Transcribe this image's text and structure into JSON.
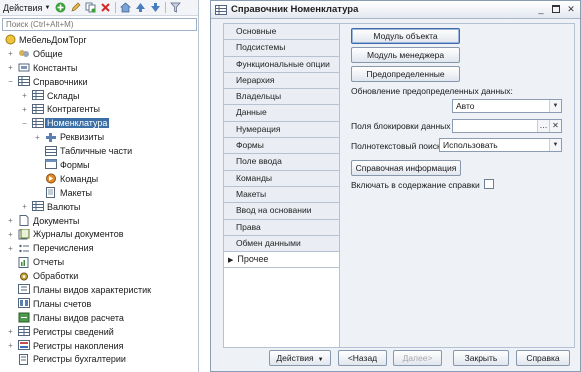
{
  "left_panel": {
    "toolbar": {
      "actions_label": "Действия",
      "icons": [
        "add-icon",
        "edit-icon",
        "copy-icon",
        "delete-icon",
        "home-icon",
        "move-up-icon",
        "move-down-icon",
        "filter-icon"
      ]
    },
    "search": {
      "placeholder": "Поиск (Ctrl+Alt+M)"
    },
    "tree": [
      {
        "label": "МебельДомТорг",
        "icon": "configuration-icon",
        "level": 0,
        "expander": ""
      },
      {
        "label": "Общие",
        "icon": "common-icon",
        "level": 1,
        "expander": "+"
      },
      {
        "label": "Константы",
        "icon": "constants-icon",
        "level": 1,
        "expander": "+"
      },
      {
        "label": "Справочники",
        "icon": "catalogs-icon",
        "level": 1,
        "expander": "−"
      },
      {
        "label": "Склады",
        "icon": "catalog-icon",
        "level": 2,
        "expander": "+"
      },
      {
        "label": "Контрагенты",
        "icon": "catalog-icon",
        "level": 2,
        "expander": "+"
      },
      {
        "label": "Номенклатура",
        "icon": "catalog-icon",
        "level": 2,
        "expander": "−",
        "selected": true
      },
      {
        "label": "Реквизиты",
        "icon": "attributes-icon",
        "level": 3,
        "expander": "+"
      },
      {
        "label": "Табличные части",
        "icon": "tabular-sections-icon",
        "level": 3,
        "expander": ""
      },
      {
        "label": "Формы",
        "icon": "forms-icon",
        "level": 3,
        "expander": ""
      },
      {
        "label": "Команды",
        "icon": "commands-icon",
        "level": 3,
        "expander": ""
      },
      {
        "label": "Макеты",
        "icon": "templates-icon",
        "level": 3,
        "expander": ""
      },
      {
        "label": "Валюты",
        "icon": "catalog-icon",
        "level": 2,
        "expander": "+"
      },
      {
        "label": "Документы",
        "icon": "documents-icon",
        "level": 1,
        "expander": "+"
      },
      {
        "label": "Журналы документов",
        "icon": "document-journals-icon",
        "level": 1,
        "expander": "+"
      },
      {
        "label": "Перечисления",
        "icon": "enums-icon",
        "level": 1,
        "expander": "+"
      },
      {
        "label": "Отчеты",
        "icon": "reports-icon",
        "level": 1,
        "expander": ""
      },
      {
        "label": "Обработки",
        "icon": "data-processors-icon",
        "level": 1,
        "expander": ""
      },
      {
        "label": "Планы видов характеристик",
        "icon": "chart-of-characteristic-types-icon",
        "level": 1,
        "expander": ""
      },
      {
        "label": "Планы счетов",
        "icon": "chart-of-accounts-icon",
        "level": 1,
        "expander": ""
      },
      {
        "label": "Планы видов расчета",
        "icon": "chart-of-calculation-types-icon",
        "level": 1,
        "expander": ""
      },
      {
        "label": "Регистры сведений",
        "icon": "information-registers-icon",
        "level": 1,
        "expander": "+"
      },
      {
        "label": "Регистры накопления",
        "icon": "accumulation-registers-icon",
        "level": 1,
        "expander": "+"
      },
      {
        "label": "Регистры бухгалтерии",
        "icon": "accounting-registers-icon",
        "level": 1,
        "expander": ""
      }
    ]
  },
  "dialog": {
    "title": "Справочник Номенклатура",
    "tabs": [
      {
        "label": "Основные"
      },
      {
        "label": "Подсистемы"
      },
      {
        "label": "Функциональные опции"
      },
      {
        "label": "Иерархия"
      },
      {
        "label": "Владельцы"
      },
      {
        "label": "Данные"
      },
      {
        "label": "Нумерация"
      },
      {
        "label": "Формы"
      },
      {
        "label": "Поле ввода"
      },
      {
        "label": "Команды"
      },
      {
        "label": "Макеты"
      },
      {
        "label": "Ввод на основании"
      },
      {
        "label": "Права"
      },
      {
        "label": "Обмен данными"
      },
      {
        "label": "Прочее",
        "active": true
      }
    ],
    "content": {
      "object_module_button": "Модуль объекта",
      "manager_module_button": "Модуль менеджера",
      "predefined_button": "Предопределенные",
      "predefined_update_label": "Обновление предопределенных данных:",
      "predefined_update_value": "Авто",
      "lock_fields_label": "Поля блокировки данных",
      "lock_fields_value": "",
      "fulltext_search_label": "Полнотекстовый поиск",
      "fulltext_search_value": "Использовать",
      "help_button": "Справочная информация",
      "include_help_label": "Включать в содержание справки",
      "include_help_checked": false
    },
    "bottom": {
      "actions_button": "Действия",
      "back_button": "<Назад",
      "next_button": "Далее>",
      "close_button": "Закрыть",
      "help_button": "Справка"
    }
  }
}
